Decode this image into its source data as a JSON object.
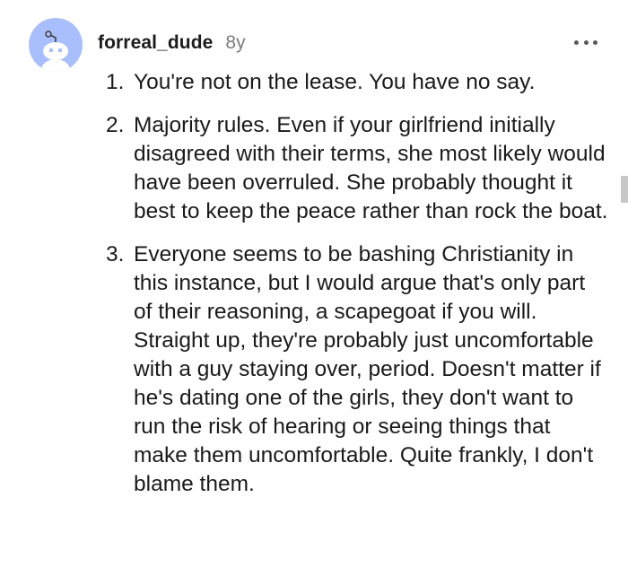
{
  "comment": {
    "username": "forreal_dude",
    "age": "8y",
    "points": [
      {
        "num": "1.",
        "text": "You're not on the lease. You have no say."
      },
      {
        "num": "2.",
        "text": "Majority rules. Even if your girlfriend initially disagreed with their terms, she most likely would have been overruled. She probably thought it best to keep the peace rather than rock the boat."
      },
      {
        "num": "3.",
        "text": "Everyone seems to be bashing Christianity in this instance, but I would argue that's only part of their reasoning, a scapegoat if you will. Straight up, they're probably just uncomfortable with a guy staying over, period. Doesn't matter if he's dating one of the girls, they don't want to run the risk of hearing or seeing things that make them uncomfortable. Quite frankly, I don't blame them."
      }
    ]
  },
  "icons": {
    "avatar": "snoo-avatar-icon",
    "more": "more-options-icon"
  },
  "colors": {
    "avatar_bg": "#a9bffd",
    "text": "#1a1a1a",
    "muted": "#7c7c7c"
  }
}
